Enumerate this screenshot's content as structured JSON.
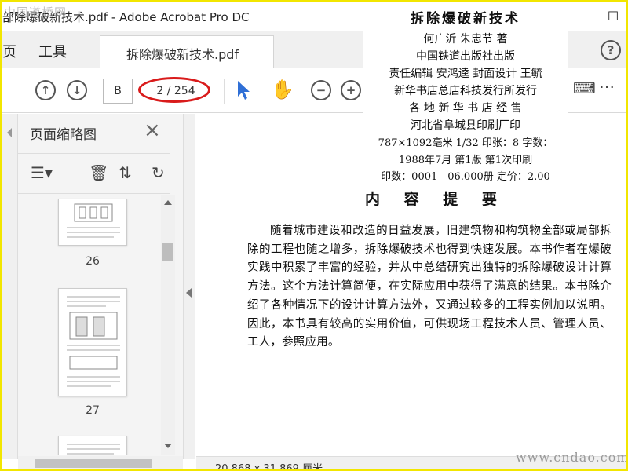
{
  "window": {
    "title": "部除爆破新技术.pdf - Adobe Acrobat Pro DC",
    "restore_icon": "restore-icon"
  },
  "menu": {
    "home_partial": "页",
    "tools": "工具"
  },
  "tab": {
    "label": "拆除爆破新技术.pdf",
    "close": "×"
  },
  "toolbar": {
    "page_input": "B",
    "page_count": "2 / 254",
    "highlight_color": "#d91b1b"
  },
  "panel": {
    "title": "页面缩略图",
    "thumbnails": [
      {
        "label": "26"
      },
      {
        "label": "27"
      }
    ]
  },
  "status": {
    "page_size": "20.868 x 31.869 厘米"
  },
  "document": {
    "copyright": {
      "title": "拆除爆破新技术",
      "authors": "何广沂  朱忠节  著",
      "publisher": "中国铁道出版社出版",
      "editors": "责任编辑  安鸿逵  封面设计  王毓",
      "distributor": "新华书店总店科技发行所发行",
      "sellers": "各 地 新 华 书 店 经 售",
      "printer": "河北省阜城县印刷厂印",
      "format": "787×1092毫米 1/32  印张：8  字数：",
      "edition": "1988年7月  第1版  第1次印刷",
      "print_run": "印数：0001—06.000册  定价：2.00"
    },
    "summary_heading": "内 容 提 要",
    "summary_text": "随着城市建设和改造的日益发展，旧建筑物和构筑物全部或局部拆除的工程也随之增多，拆除爆破技术也得到快速发展。本书作者在爆破实践中积累了丰富的经验，并从中总结研究出独特的拆除爆破设计计算方法。这个方法计算简便，在实际应用中获得了满意的结果。本书除介绍了各种情况下的设计计算方法外，又通过较多的工程实例加以说明。因此，本书具有较高的实用价值，可供现场工程技术人员、管理人员、工人，参照应用。"
  },
  "watermarks": {
    "top": "中国道桥网",
    "bottom": "www.cndao.com"
  },
  "colors": {
    "frame": "#f2e600",
    "cursor_blue": "#2f6fd6"
  }
}
